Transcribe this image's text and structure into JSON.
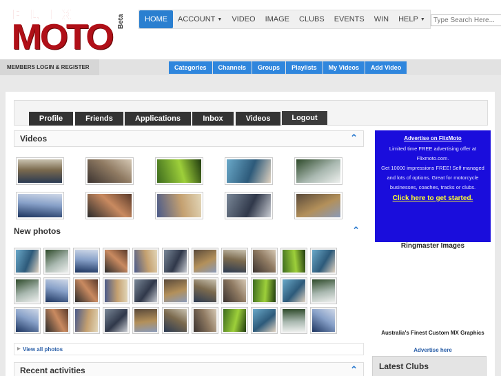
{
  "logo": {
    "line1": "FLIX",
    "line2": "MOTO",
    "badge": "Beta"
  },
  "topnav": [
    {
      "label": "HOME",
      "active": true,
      "caret": false
    },
    {
      "label": "ACCOUNT",
      "active": false,
      "caret": true
    },
    {
      "label": "VIDEO",
      "active": false,
      "caret": false
    },
    {
      "label": "IMAGE",
      "active": false,
      "caret": false
    },
    {
      "label": "CLUBS",
      "active": false,
      "caret": false
    },
    {
      "label": "EVENTS",
      "active": false,
      "caret": false
    },
    {
      "label": "WIN",
      "active": false,
      "caret": false
    },
    {
      "label": "HELP",
      "active": false,
      "caret": true
    }
  ],
  "search": {
    "placeholder": "Type Search Here..."
  },
  "members_label": "MEMBERS LOGIN & REGISTER",
  "subnav": [
    "Categories",
    "Channels",
    "Groups",
    "Playlists",
    "My Videos",
    "Add Video"
  ],
  "tabs": [
    "Profile",
    "Friends",
    "Applications",
    "Inbox",
    "Videos",
    "Logout"
  ],
  "videos": {
    "title": "Videos",
    "thumbs": [
      "motocross-stadium",
      "motocross-track",
      "trail-riding-green",
      "rider-portrait-blue",
      "car-forest-road",
      "stadium-dirt-jump",
      "man-talking-closeup",
      "supercross-stadium",
      "road-bike-helmet-cam",
      "supercross-night"
    ]
  },
  "photos": {
    "title": "New photos",
    "view_all": "View all photos",
    "thumbs": [
      "bike-wheelie-1",
      "sport-bike-1",
      "motocross-race-1",
      "group-riders-1",
      "red-bike-night",
      "bikes-parade",
      "racers-track",
      "stunt-bike-1",
      "dirt-jump-1",
      "mx-jump-sky",
      "blue-bike-1",
      "bike-sunset",
      "crowd-show",
      "mx-race-2",
      "motogp-lean",
      "burnout-smoke",
      "mx-crowd",
      "burnout-2",
      "blue-sky-jump",
      "festival-crowd",
      "fire-show",
      "stunt-bike-2",
      "wheelie-2",
      "blue-sportbike",
      "mx-pack",
      "yellow-bike",
      "blue-bike-stunt",
      "forest-ride",
      "wheelie-3",
      "mx-mud",
      "mx-race-3",
      "stadium-jump",
      "red-bike-2"
    ]
  },
  "ad": {
    "title": "Advertise on FlixMoto",
    "line1": "Limited time FREE advertising offer at Flixmoto.com.",
    "line2": "Get 10000 impressions FREE! Self managed and lots of options. Great for motorcycle businesses, coaches, tracks or clubs.",
    "cta": "Click here to get started."
  },
  "sponsor1": "Ringmaster Images",
  "sponsor2": "Australia's Finest Custom MX Graphics",
  "advertise_here": "Advertise here",
  "recent_activities": "Recent activities",
  "latest_clubs": "Latest Clubs",
  "colors": {
    "accent": "#2f86dd",
    "brand": "#b01018",
    "ad_bg": "#1a0ddc",
    "ad_cta": "#ffff30"
  }
}
